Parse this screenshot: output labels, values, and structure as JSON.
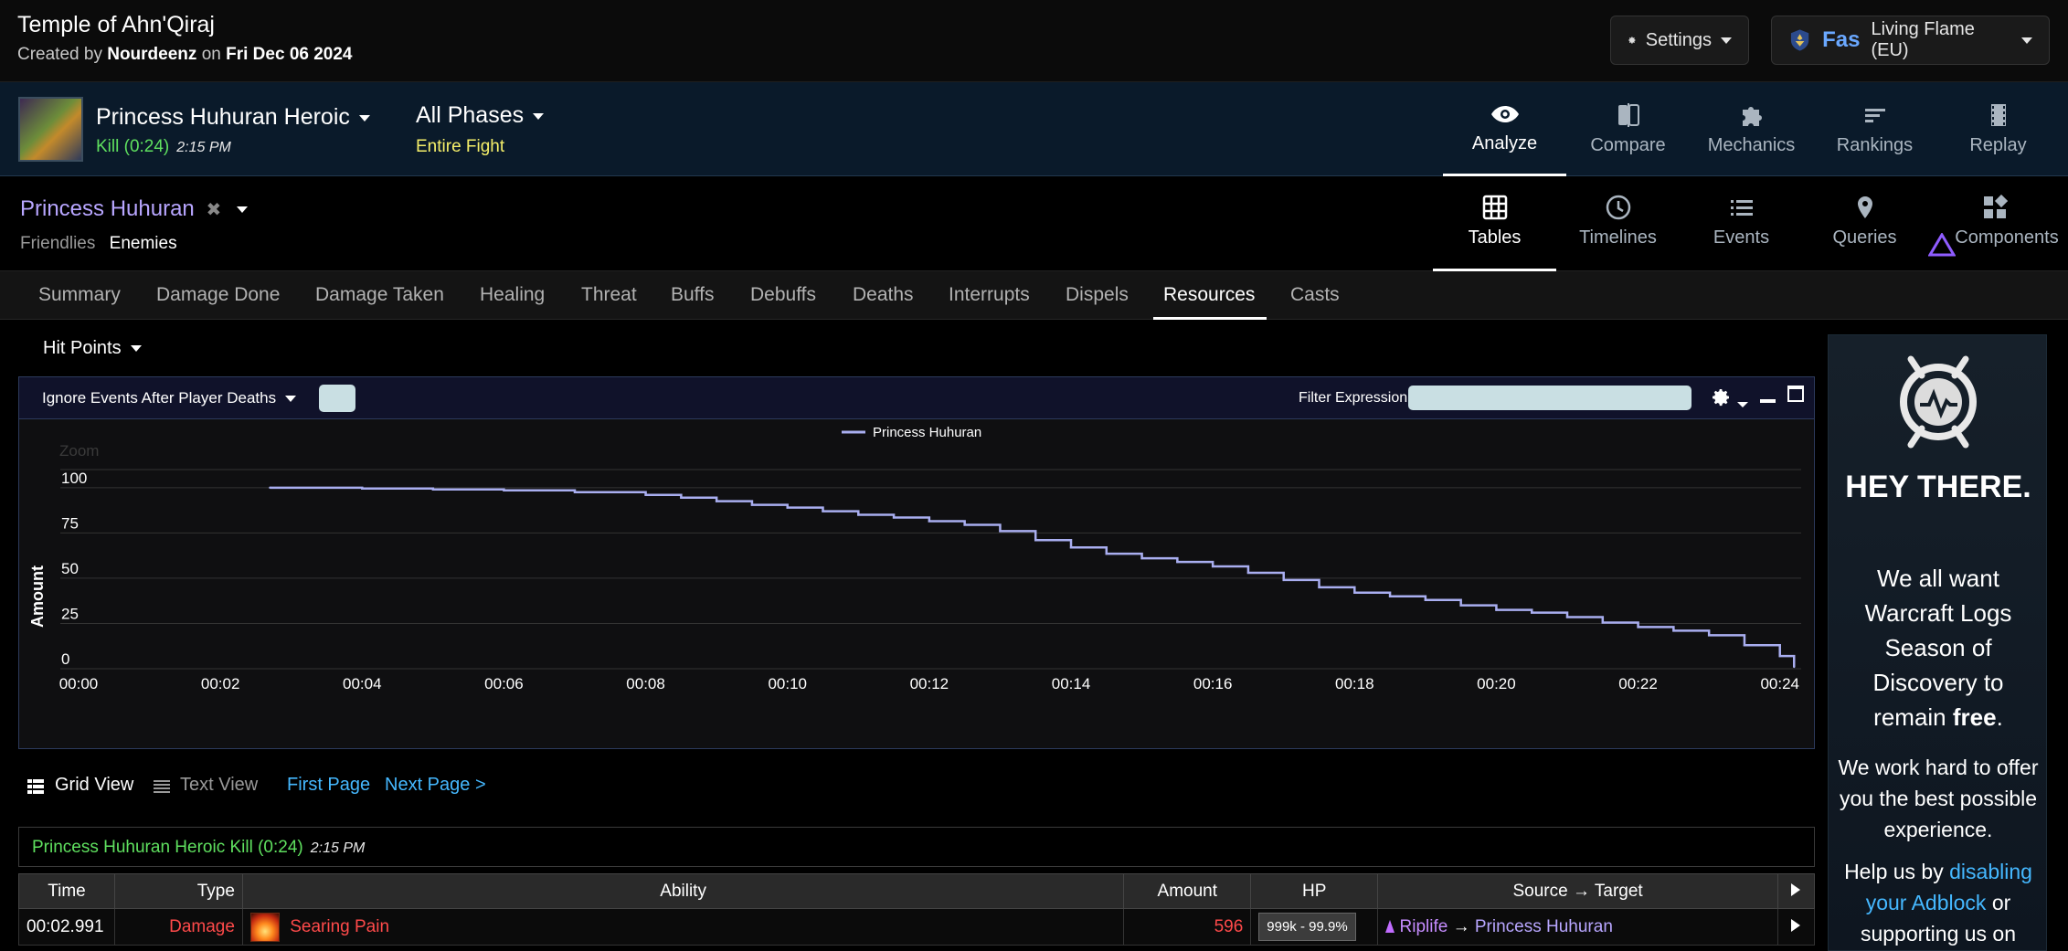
{
  "header": {
    "title": "Temple of Ahn'Qiraj",
    "created_prefix": "Created by",
    "author": "Nourdeenz",
    "on_text": "on",
    "date": "Fri Dec 06 2024",
    "settings_label": "Settings",
    "character_name": "Fas",
    "realm": "Living Flame (EU)"
  },
  "fight": {
    "name": "Princess Huhuran Heroic",
    "result": "Kill (0:24)",
    "time": "2:15 PM",
    "phase": "All Phases",
    "phase_sub": "Entire Fight"
  },
  "main_nav": [
    {
      "label": "Analyze",
      "icon": "eye-icon",
      "active": true
    },
    {
      "label": "Compare",
      "icon": "compare-icon",
      "active": false
    },
    {
      "label": "Mechanics",
      "icon": "puzzle-icon",
      "active": false
    },
    {
      "label": "Rankings",
      "icon": "rankings-icon",
      "active": false
    },
    {
      "label": "Replay",
      "icon": "film-icon",
      "active": false
    }
  ],
  "actor": {
    "name": "Princess Huhuran",
    "friendlies": "Friendlies",
    "enemies": "Enemies"
  },
  "view_nav": [
    {
      "label": "Tables",
      "icon": "grid-icon",
      "active": true
    },
    {
      "label": "Timelines",
      "icon": "clock-icon",
      "active": false
    },
    {
      "label": "Events",
      "icon": "list-icon",
      "active": false
    },
    {
      "label": "Queries",
      "icon": "map-pin-icon",
      "active": false
    },
    {
      "label": "Components",
      "icon": "components-icon",
      "active": false
    }
  ],
  "section_tabs": [
    "Summary",
    "Damage Done",
    "Damage Taken",
    "Healing",
    "Threat",
    "Buffs",
    "Debuffs",
    "Deaths",
    "Interrupts",
    "Dispels",
    "Resources",
    "Casts"
  ],
  "active_section": "Resources",
  "resource": {
    "selected": "Hit Points",
    "ignore_label": "Ignore Events After Player Deaths",
    "filter_label": "Filter Expression:",
    "filter_value": ""
  },
  "chart_data": {
    "type": "line",
    "title": "",
    "zoom_label": "Zoom",
    "xlabel": "",
    "ylabel": "Amount",
    "xlim": [
      0,
      24.3
    ],
    "ylim": [
      0,
      110
    ],
    "x_ticks": [
      "00:00",
      "00:02",
      "00:04",
      "00:06",
      "00:08",
      "00:10",
      "00:12",
      "00:14",
      "00:16",
      "00:18",
      "00:20",
      "00:22",
      "00:24"
    ],
    "y_ticks": [
      "0",
      "25",
      "50",
      "75",
      "100"
    ],
    "grid": true,
    "legend_position": "top-center",
    "series": [
      {
        "name": "Princess Huhuran",
        "color": "#a9aef0",
        "x": [
          2.7,
          4.0,
          5.0,
          6.0,
          7.0,
          8.0,
          8.5,
          9.0,
          9.5,
          10.0,
          10.5,
          11.0,
          11.5,
          12.0,
          12.5,
          13.0,
          13.5,
          14.0,
          14.5,
          15.0,
          15.5,
          16.0,
          16.5,
          17.0,
          17.5,
          18.0,
          18.5,
          19.0,
          19.5,
          20.0,
          20.5,
          21.0,
          21.5,
          22.0,
          22.5,
          23.0,
          23.5,
          24.0,
          24.2
        ],
        "y": [
          100,
          99.5,
          99,
          98.5,
          97.5,
          96,
          94.5,
          92.5,
          90.5,
          89,
          87,
          85,
          83.5,
          81.5,
          79.5,
          76,
          71,
          67,
          63.5,
          61,
          59,
          56.5,
          53,
          49,
          45,
          42,
          40,
          38,
          35,
          32.5,
          31,
          28.5,
          25.5,
          23,
          21,
          18.5,
          13,
          7,
          1
        ]
      }
    ]
  },
  "view_controls": {
    "grid_view": "Grid View",
    "text_view": "Text View",
    "first_page": "First Page",
    "next_page": "Next Page >"
  },
  "summary": {
    "text": "Princess Huhuran Heroic Kill (0:24)",
    "time": "2:15 PM"
  },
  "table": {
    "headers": [
      "Time",
      "Type",
      "Ability",
      "Amount",
      "HP",
      "Source → Target"
    ],
    "rows": [
      {
        "time": "00:02.991",
        "type": "Damage",
        "ability": "Searing Pain",
        "amount": "596",
        "hp": "999k - 99.9%",
        "source": "Riplife",
        "arrow": "→",
        "target": "Princess Huhuran"
      }
    ]
  },
  "ad": {
    "headline": "HEY THERE.",
    "body1_a": "We all want Warcraft Logs Season of Discovery to remain",
    "body1_b": "free",
    "body2": "We work hard to offer you the best possible experience.",
    "body3_a": "Help us by",
    "body3_link": "disabling your Adblock",
    "body3_b": "or supporting us on"
  },
  "colors": {
    "kill_green": "#5fe05f",
    "phase_yellow": "#f6f06a",
    "link_blue": "#45b8ff",
    "boss_purple": "#b8a6ff",
    "damage_red": "#ff4a4a",
    "series_line": "#a9aef0"
  }
}
